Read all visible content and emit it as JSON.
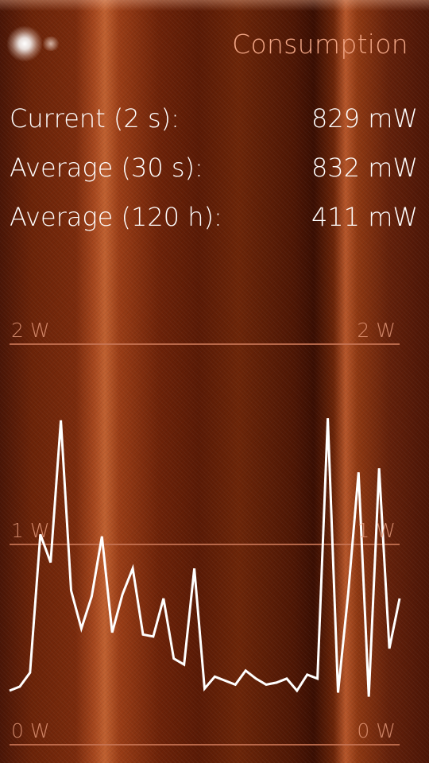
{
  "header": {
    "title": "Consumption",
    "glow_icon": "light-glow-icon"
  },
  "stats": [
    {
      "label": "Current (2 s):",
      "value": "829 mW"
    },
    {
      "label": "Average (30 s):",
      "value": "832 mW"
    },
    {
      "label": "Average (120 h):",
      "value": "411 mW"
    }
  ],
  "colors": {
    "background": "#6b2308",
    "accent": "#f0a585",
    "line": "#ffffff",
    "gridline": "#c97556"
  },
  "chart_data": {
    "type": "line",
    "ylim": [
      0,
      2
    ],
    "y_ticks": [
      {
        "value": 2,
        "label": "2 W"
      },
      {
        "value": 1,
        "label": "1 W"
      },
      {
        "value": 0,
        "label": "0 W"
      }
    ],
    "unit": "W",
    "series": [
      {
        "values": [
          0.27,
          0.29,
          0.36,
          1.05,
          0.91,
          1.62,
          0.77,
          0.58,
          0.74,
          1.04,
          0.56,
          0.75,
          0.88,
          0.55,
          0.54,
          0.73,
          0.43,
          0.4,
          0.88,
          0.28,
          0.34,
          0.32,
          0.3,
          0.37,
          0.33,
          0.3,
          0.31,
          0.33,
          0.27,
          0.35,
          0.33,
          1.63,
          0.26,
          0.76,
          1.36,
          0.24,
          1.38,
          0.48,
          0.73
        ]
      }
    ]
  }
}
